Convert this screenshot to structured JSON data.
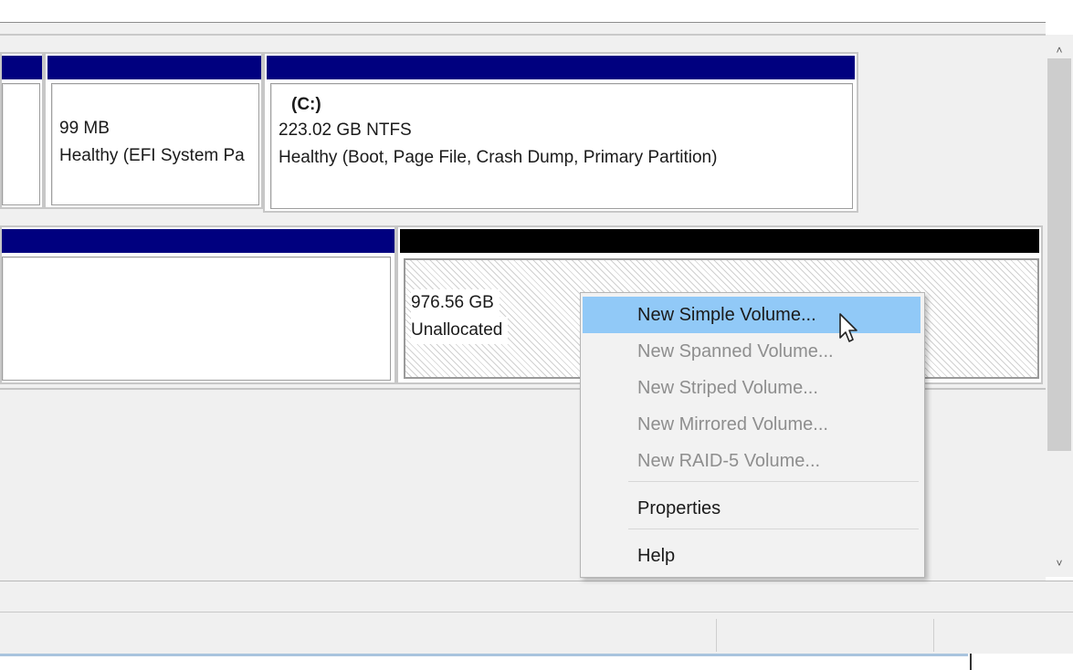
{
  "disk0": {
    "efi": {
      "size": "99 MB",
      "status": "Healthy (EFI System Pa"
    },
    "c_drive": {
      "label": "(C:)",
      "size": "223.02 GB NTFS",
      "status": "Healthy (Boot, Page File, Crash Dump, Primary Partition)"
    }
  },
  "disk1": {
    "unallocated": {
      "size": "976.56 GB",
      "status": "Unallocated"
    }
  },
  "context_menu": {
    "items": [
      {
        "label": "New Simple Volume...",
        "enabled": true,
        "highlighted": true
      },
      {
        "label": "New Spanned Volume...",
        "enabled": false
      },
      {
        "label": "New Striped Volume...",
        "enabled": false
      },
      {
        "label": "New Mirrored Volume...",
        "enabled": false
      },
      {
        "label": "New RAID-5 Volume...",
        "enabled": false
      },
      {
        "label": "Properties",
        "enabled": true
      },
      {
        "label": "Help",
        "enabled": true
      }
    ]
  },
  "scrollbar": {
    "up_glyph": "˄",
    "down_glyph": "˅"
  },
  "colors": {
    "partition_header": "#00007f",
    "unallocated_header": "#000000",
    "menu_highlight": "#91c9f7",
    "disabled_text": "#8e8e8e"
  },
  "icons": {
    "cursor": "arrow-cursor-icon"
  }
}
